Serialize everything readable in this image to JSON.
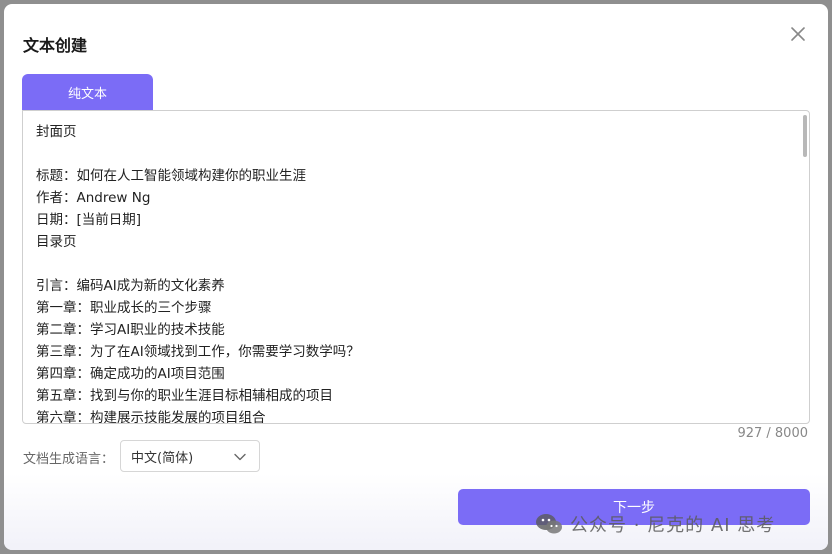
{
  "dialog": {
    "title": "文本创建",
    "tab_label": "纯文本",
    "editor_lines": [
      "封面页",
      "",
      "标题：如何在人工智能领域构建你的职业生涯",
      "作者：Andrew Ng",
      "日期：[当前日期]",
      "目录页",
      "",
      "引言：编码AI成为新的文化素养",
      "第一章：职业成长的三个步骤",
      "第二章：学习AI职业的技术技能",
      "第三章：为了在AI领域找到工作，你需要学习数学吗？",
      "第四章：确定成功的AI项目范围",
      "第五章：找到与你的职业生涯目标相辅相成的项目",
      "第六章：构建展示技能发展的项目组合"
    ],
    "char_count": "927 / 8000",
    "language_label": "文档生成语言：",
    "language_value": "中文(简体)",
    "next_button": "下一步"
  },
  "watermark": {
    "text": "公众号 · 尼克的 AI 思考",
    "icon": "wechat-icon"
  },
  "icons": {
    "close": "close-icon",
    "dropdown": "chevron-down-icon"
  },
  "colors": {
    "accent": "#7b6cf6",
    "overlay": "#8f8f8f"
  }
}
